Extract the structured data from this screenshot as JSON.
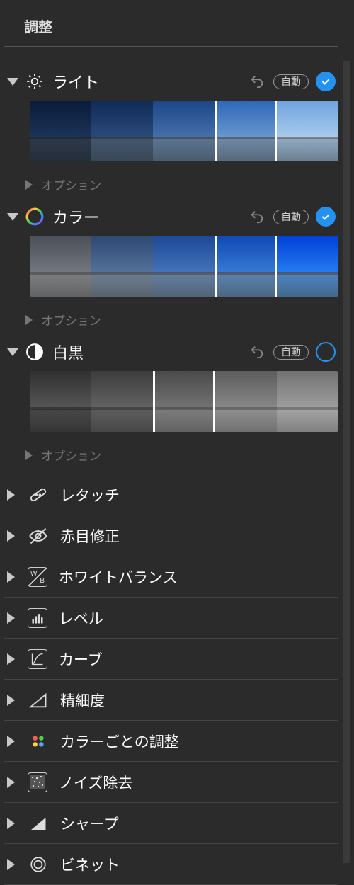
{
  "header": {
    "title": "調整"
  },
  "panels": {
    "light": {
      "label": "ライト",
      "auto": "自動",
      "options": "オプション",
      "checked": true
    },
    "color": {
      "label": "カラー",
      "auto": "自動",
      "options": "オプション",
      "checked": true
    },
    "bw": {
      "label": "白黒",
      "auto": "自動",
      "options": "オプション",
      "checked": false
    }
  },
  "items": [
    {
      "label": "レタッチ",
      "icon": "bandage"
    },
    {
      "label": "赤目修正",
      "icon": "eye-off"
    },
    {
      "label": "ホワイトバランス",
      "icon": "wb"
    },
    {
      "label": "レベル",
      "icon": "levels"
    },
    {
      "label": "カーブ",
      "icon": "curves"
    },
    {
      "label": "精細度",
      "icon": "triangle-outline"
    },
    {
      "label": "カラーごとの調整",
      "icon": "palette"
    },
    {
      "label": "ノイズ除去",
      "icon": "noise"
    },
    {
      "label": "シャープ",
      "icon": "triangle-solid"
    },
    {
      "label": "ビネット",
      "icon": "vignette"
    }
  ]
}
